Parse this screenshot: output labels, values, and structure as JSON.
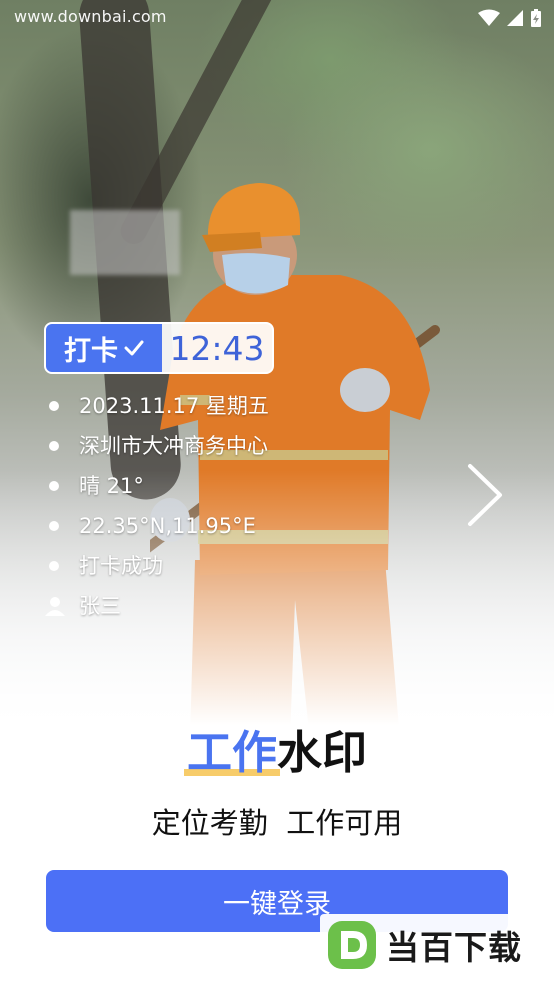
{
  "status_bar": {
    "site_watermark": "www.downbai.com",
    "icons": [
      "wifi-icon",
      "cellular-signal-icon",
      "battery-charging-icon"
    ]
  },
  "stamp": {
    "check_in_label": "打卡",
    "check_icon": "checkmark-icon",
    "time": "12:43",
    "accent_color": "#4a74f0"
  },
  "info": {
    "date_weekday": "2023.11.17  星期五",
    "location": "深圳市大冲商务中心",
    "weather": "晴  21°",
    "coordinates": "22.35°N,11.95°E",
    "status": "打卡成功",
    "user_name": "张三"
  },
  "carousel": {
    "next_icon": "chevron-right-icon"
  },
  "hero": {
    "title_highlight": "工作",
    "title_rest": "水印",
    "subtitle": "定位考勤  工作可用"
  },
  "login": {
    "button_label": "一键登录",
    "button_color": "#4c70f6"
  },
  "watermark_logo": {
    "text": "当百下载",
    "icon": "d-logo-icon"
  }
}
